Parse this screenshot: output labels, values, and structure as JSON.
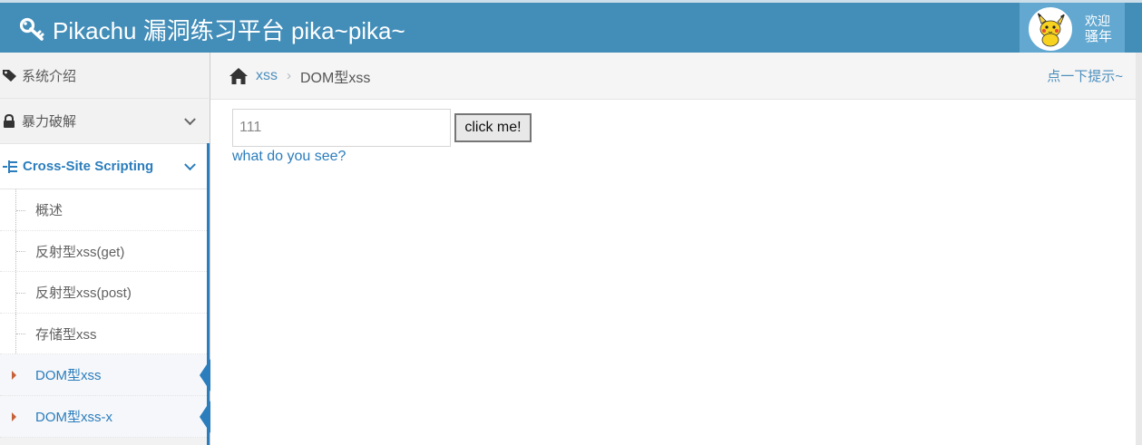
{
  "header": {
    "title": "Pikachu 漏洞练习平台 pika~pika~",
    "welcome_line1": "欢迎",
    "welcome_line2": "骚年"
  },
  "sidebar": {
    "items": [
      {
        "label": "系统介绍",
        "icon": "tags-icon"
      },
      {
        "label": "暴力破解",
        "icon": "lock-icon"
      },
      {
        "label": "Cross-Site Scripting",
        "icon": "sitemap-icon"
      }
    ],
    "subitems": [
      {
        "label": "概述"
      },
      {
        "label": "反射型xss(get)"
      },
      {
        "label": "反射型xss(post)"
      },
      {
        "label": "存储型xss"
      },
      {
        "label": "DOM型xss"
      },
      {
        "label": "DOM型xss-x"
      }
    ]
  },
  "breadcrumb": {
    "link": "xss",
    "current": "DOM型xss",
    "hint": "点一下提示~"
  },
  "main": {
    "input_value": "111",
    "button_label": "click me!",
    "result_text": "what do you see?"
  },
  "colors": {
    "header_bg": "#438eb9",
    "accent": "#2b7dbc",
    "caret": "#c86139"
  }
}
